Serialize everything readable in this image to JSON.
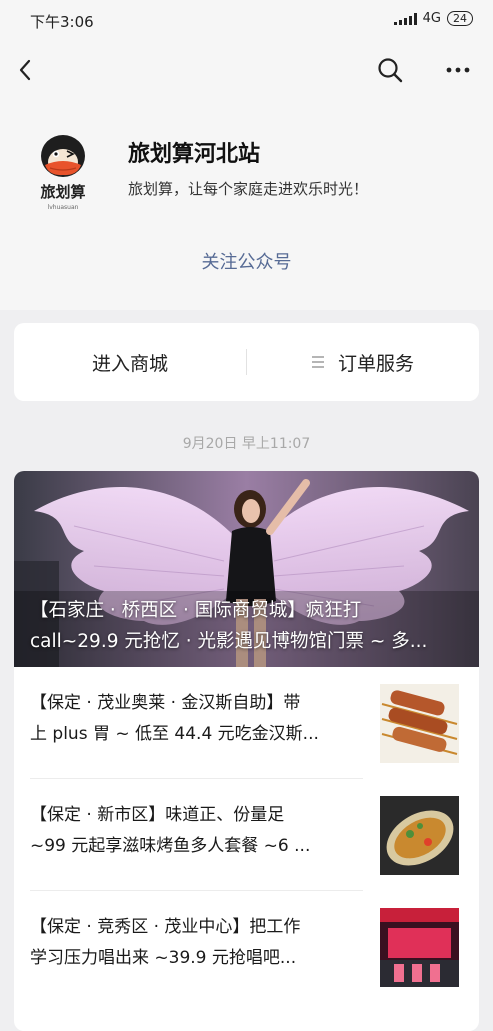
{
  "status_bar": {
    "time": "下午3:06",
    "network": "4G",
    "battery": "24"
  },
  "account": {
    "name": "旅划算河北站",
    "description": "旅划算，让每个家庭走进欢乐时光！",
    "logo_text": "旅划算",
    "logo_subtext": "lvhuasuan"
  },
  "follow_label": "关注公众号",
  "menu": {
    "item1": "进入商城",
    "item2": "订单服务"
  },
  "message_time": "9月20日 早上11:07",
  "articles": {
    "hero": {
      "line1": "【石家庄 · 桥西区 · 国际商贸城】疯狂打",
      "line2": "call~29.9 元抢忆 · 光影遇见博物馆门票 ~ 多..."
    },
    "items": [
      {
        "line1": "【保定 · 茂业奥莱 · 金汉斯自助】带",
        "line2": "上 plus 胃 ~ 低至 44.4 元吃金汉斯..."
      },
      {
        "line1": "【保定 · 新市区】味道正、份量足",
        "line2": "~99 元起享滋味烤鱼多人套餐 ~6 ..."
      },
      {
        "line1": "【保定 · 竞秀区 · 茂业中心】把工作",
        "line2": "学习压力唱出来 ~39.9 元抢唱吧..."
      }
    ]
  },
  "colors": {
    "link": "#576b95",
    "background": "#efeff1",
    "header": "#f6f6f6"
  },
  "icons": [
    "back-arrow-icon",
    "search-icon",
    "more-icon",
    "list-icon"
  ]
}
